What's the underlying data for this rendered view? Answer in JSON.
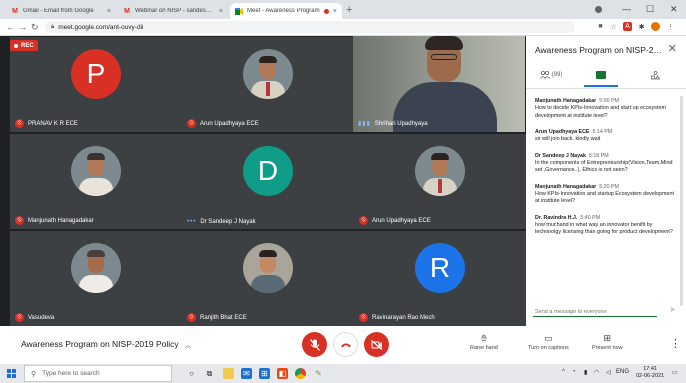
{
  "browser": {
    "tabs": [
      {
        "title": "Gmail - Email from Google",
        "favicon": "gmail-icon",
        "active": false
      },
      {
        "title": "Webinar on NISP - sandeshuc@",
        "favicon": "gmail-icon",
        "active": false
      },
      {
        "title": "Meet - Awareness Program",
        "favicon": "meet-icon",
        "active": true,
        "recording": true
      }
    ],
    "new_tab_glyph": "+",
    "url": "meet.google.com/ant-ouvy-dii"
  },
  "meeting": {
    "rec_label": "REC",
    "participants": [
      {
        "name": "PRANAV K R ECE",
        "type": "initial",
        "initial": "P",
        "color": "#d93025",
        "muted": true
      },
      {
        "name": "Arun Upadhyaya ECE",
        "type": "photo",
        "muted": true
      },
      {
        "name": "Shrihari Upadhyaya",
        "type": "video",
        "muted": false,
        "speaking": true
      },
      {
        "name": "Manjunath Hanagadakar",
        "type": "photo",
        "muted": true
      },
      {
        "name": "Dr Sandeep J Nayak",
        "type": "initial",
        "initial": "D",
        "color": "#0f9d8a",
        "muted": false
      },
      {
        "name": "Arun Upadhyaya ECE",
        "type": "photo",
        "muted": true
      },
      {
        "name": "Vasudeva",
        "type": "photo",
        "muted": true
      },
      {
        "name": "Ranjith Bhat ECE",
        "type": "photo",
        "muted": true
      },
      {
        "name": "Ravinarayan Rao Mech",
        "type": "initial",
        "initial": "R",
        "color": "#1a73e8",
        "muted": true
      }
    ]
  },
  "panel": {
    "title": "Awareness Program on NISP-201...",
    "tabs": [
      {
        "label": "(99)",
        "icon": "people-icon"
      },
      {
        "label": "",
        "icon": "chat-icon"
      },
      {
        "label": "",
        "icon": "activities-icon"
      }
    ],
    "messages": [
      {
        "author": "Manjunath Hanagadakar",
        "time": "5:00 PM",
        "text": "How to decide KPIs-Innovation and start up ecosystem development at institute level?"
      },
      {
        "author": "Arun Upadhyaya ECE",
        "time": "5:14 PM",
        "text": "sir will join back. kindly wait"
      },
      {
        "author": "Dr Sandeep J Nayak",
        "time": "5:18 PM",
        "text": "In the components of Entrepreneurship(Vision,Team,Mind set ,Governance..), Ethics is not seen?"
      },
      {
        "author": "Manjunath Hanagadakar",
        "time": "5:20 PM",
        "text": "How KPIs-Innovation and startup Ecosystem development at institute level?"
      },
      {
        "author": "Dr. Ravindra H.J.",
        "time": "5:40 PM",
        "text": "how muchand in what way an innovator benifit by techonolgy licensing than going for product development?"
      }
    ],
    "compose_placeholder": "Send a message to everyone"
  },
  "controls": {
    "meeting_title": "Awareness Program on NISP-2019 Policy",
    "raise_hand": "Raise hand",
    "captions": "Turn on captions",
    "present": "Present now"
  },
  "taskbar": {
    "search_placeholder": "Type here to search",
    "tray_lang": "ENG",
    "time": "17:41",
    "date": "02-06-2021"
  },
  "colors": {
    "meet_red": "#d93025",
    "meet_green": "#137333",
    "tile_bg": "#3c4043",
    "stage_bg": "#202124"
  }
}
